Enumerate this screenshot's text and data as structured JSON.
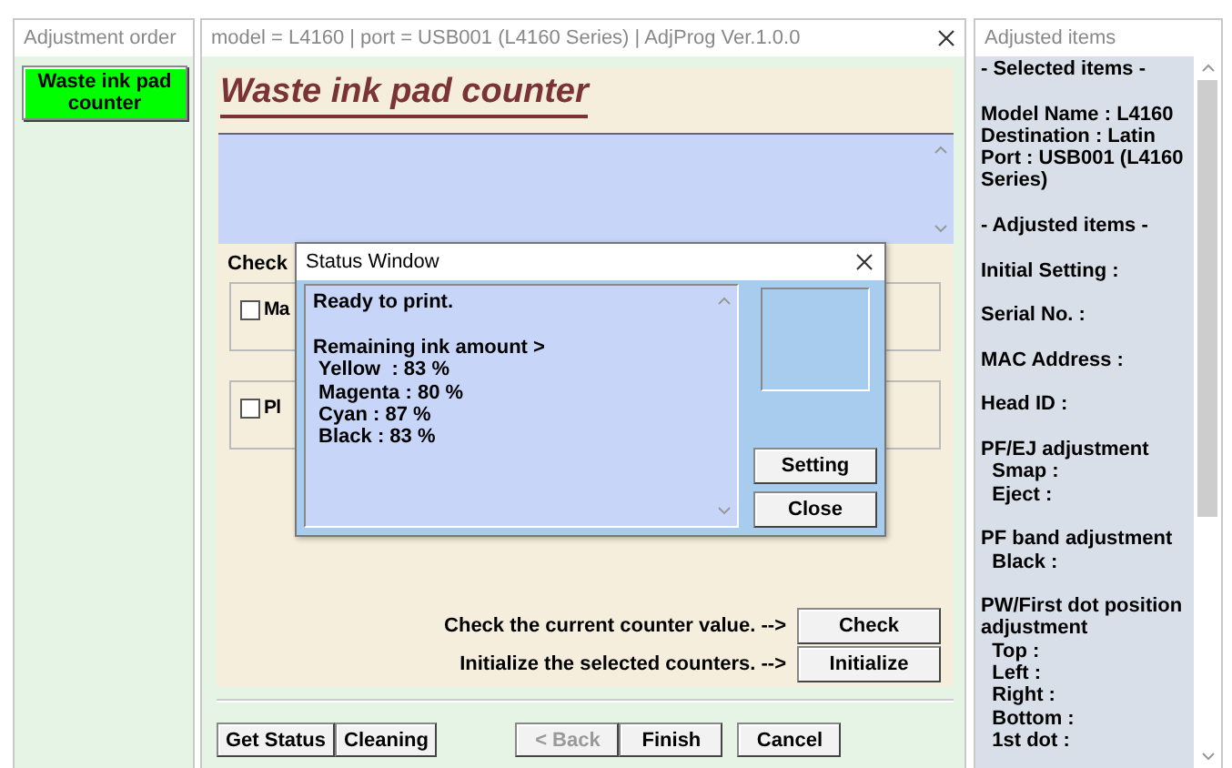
{
  "adjustment_order": {
    "title": "Adjustment order",
    "items": [
      {
        "label": "Waste ink pad counter",
        "selected": true
      }
    ]
  },
  "main_window": {
    "title": "model = L4160 | port = USB001 (L4160 Series) | AdjProg Ver.1.0.0",
    "heading": "Waste ink pad counter",
    "group_label": "Check",
    "options": [
      {
        "label": "Ma",
        "checked": false
      },
      {
        "label": "Pl",
        "checked": false
      }
    ],
    "actions": [
      {
        "text": "Check the current counter value. -->",
        "button": "Check"
      },
      {
        "text": "Initialize the selected counters. -->",
        "button": "Initialize"
      }
    ],
    "left_buttons": [
      {
        "label": "Get Status",
        "disabled": false
      },
      {
        "label": "Cleaning",
        "disabled": false
      }
    ],
    "nav_buttons": [
      {
        "label": "< Back",
        "disabled": true
      },
      {
        "label": "Finish",
        "disabled": false
      },
      {
        "label": "Cancel",
        "disabled": false
      }
    ]
  },
  "status_window": {
    "title": "Status Window",
    "paragraphs": [
      [
        "Ready to print."
      ],
      [
        "Remaining ink amount >",
        " Yellow  : 83 %",
        " Magenta : 80 %",
        " Cyan : 87 %",
        " Black : 83 %"
      ]
    ],
    "buttons": [
      "Setting",
      "Close"
    ]
  },
  "adjusted_items": {
    "title": "Adjusted items",
    "paragraphs": [
      [
        "- Selected items -"
      ],
      [
        "Model Name : L4160",
        "Destination : Latin",
        "Port : USB001 (L4160 Series)"
      ],
      [
        "- Adjusted items -"
      ],
      [
        "Initial Setting :"
      ],
      [
        "Serial No. :"
      ],
      [
        "MAC Address :"
      ],
      [
        "Head ID :"
      ],
      [
        "PF/EJ adjustment",
        "  Smap :",
        "  Eject :"
      ],
      [
        "PF band adjustment",
        "  Black :"
      ],
      [
        "PW/First dot position adjustment",
        "  Top :",
        "  Left :",
        "  Right :",
        "  Bottom :",
        "  1st dot :"
      ]
    ]
  }
}
